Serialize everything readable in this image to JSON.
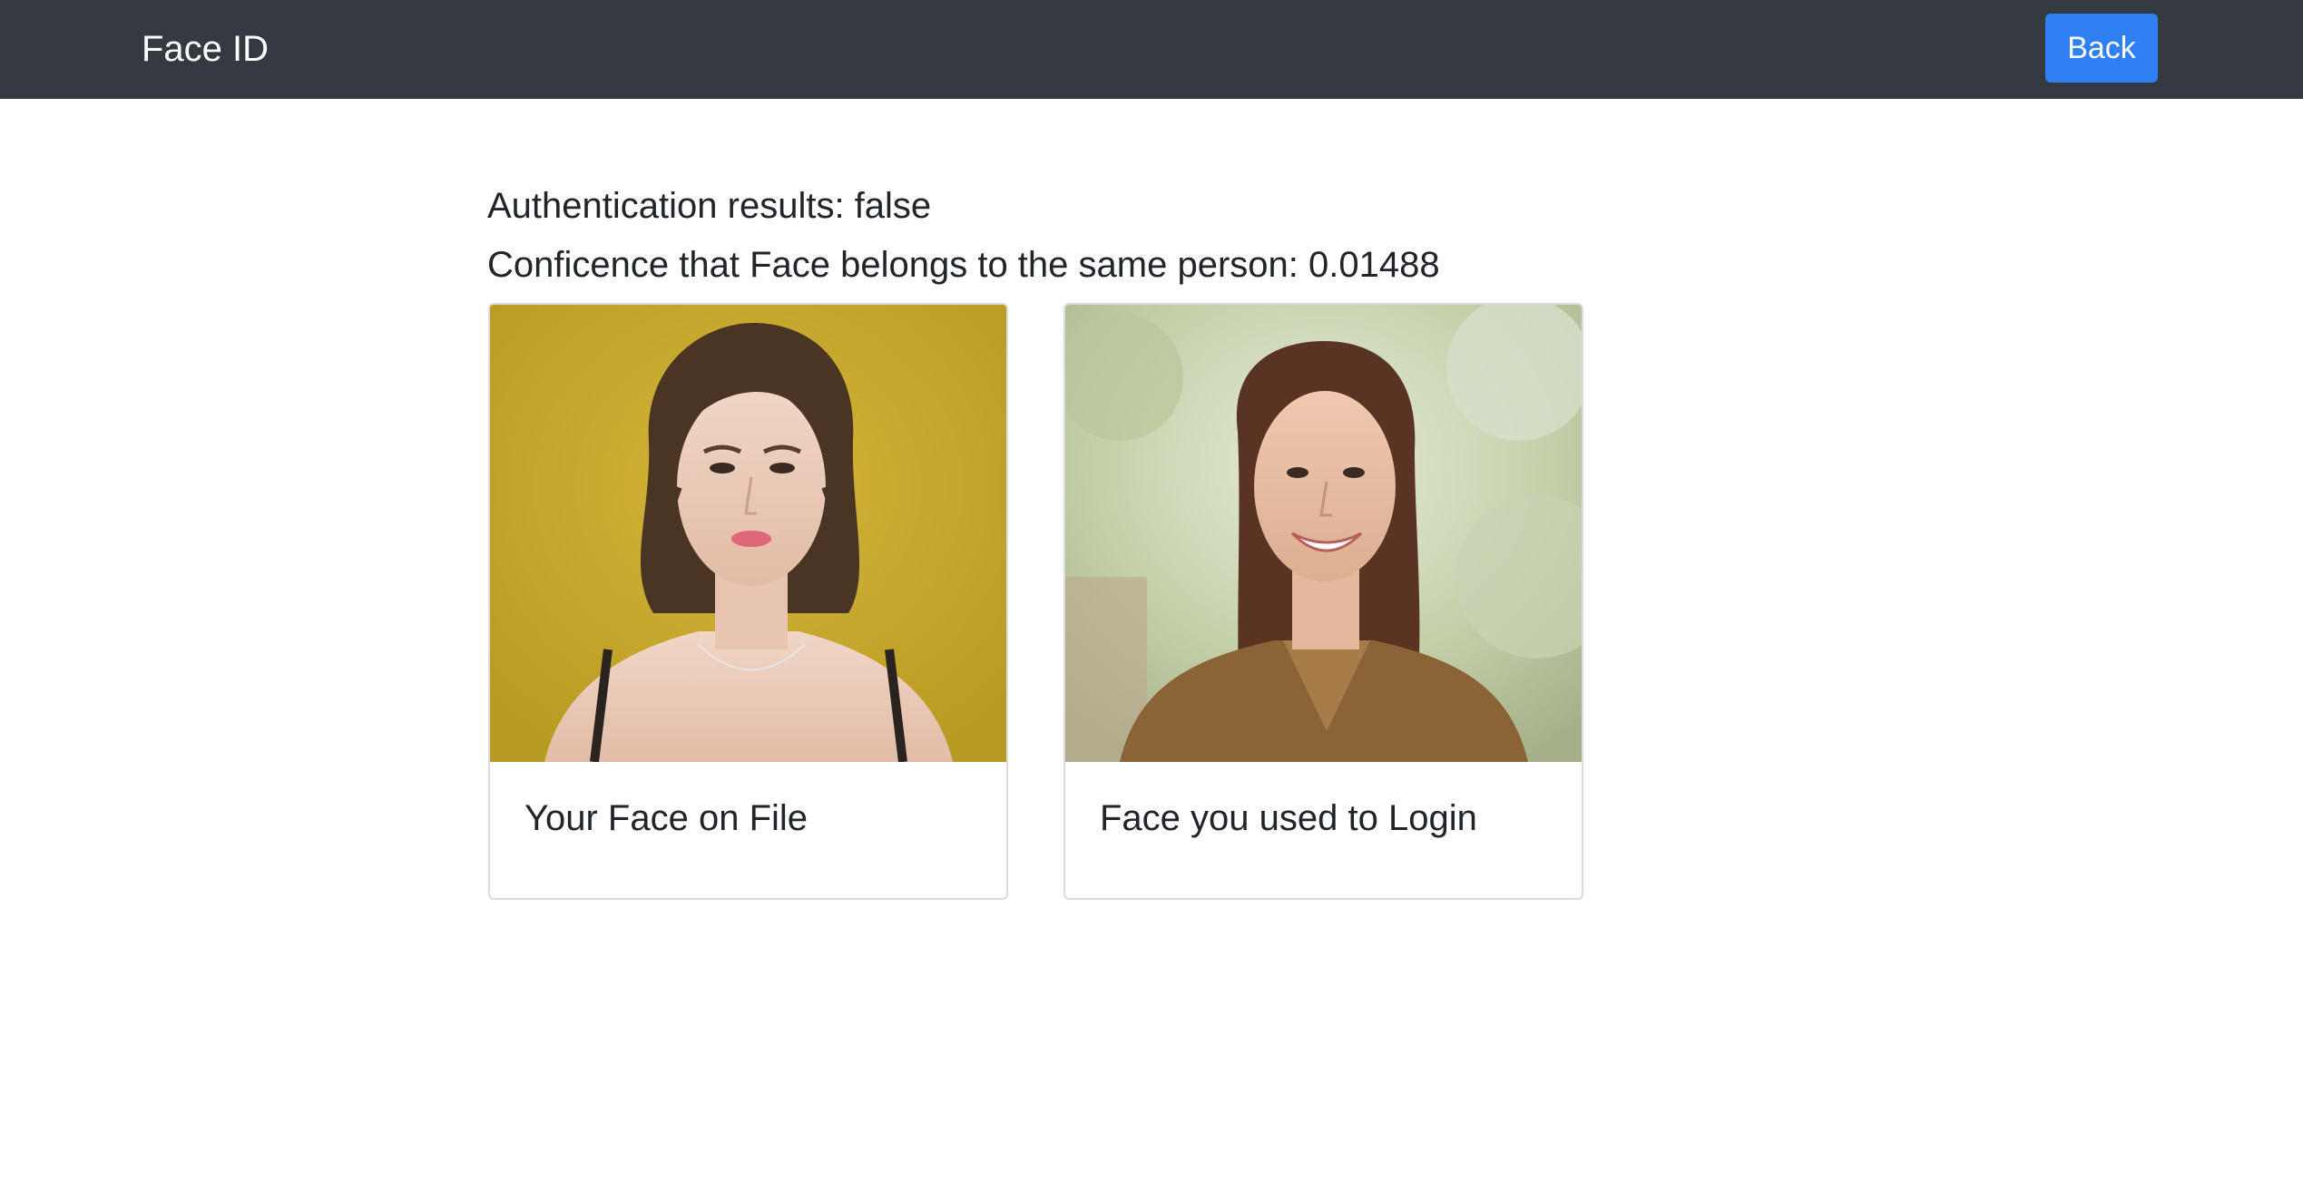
{
  "navbar": {
    "brand": "Face ID",
    "back_label": "Back"
  },
  "results": {
    "auth_line": "Authentication results: false",
    "confidence_line": "Conficence that Face belongs to the same person: 0.01488"
  },
  "cards": [
    {
      "title": "Your Face on File"
    },
    {
      "title": "Face you used to Login"
    }
  ],
  "colors": {
    "navbar_bg": "#343a40",
    "back_button_bg": "#2f80f5"
  }
}
